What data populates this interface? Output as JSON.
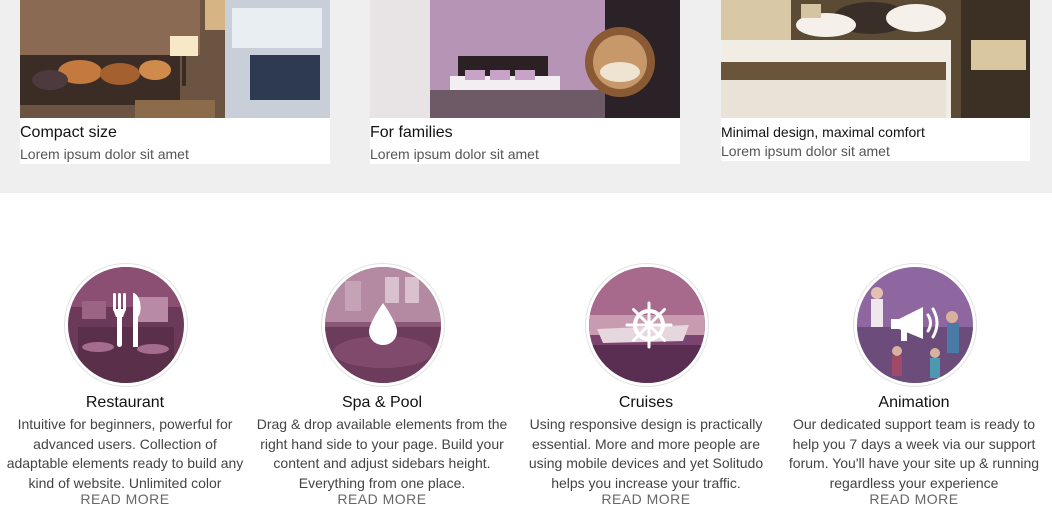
{
  "rooms": [
    {
      "title": "Compact size",
      "subtitle": "Lorem ipsum dolor sit amet"
    },
    {
      "title": "For families",
      "subtitle": "Lorem ipsum dolor sit amet"
    },
    {
      "title": "Minimal design, maximal comfort",
      "subtitle": "Lorem ipsum dolor sit amet"
    }
  ],
  "services": [
    {
      "title": "Restaurant",
      "icon": "fork-knife-icon",
      "lines": [
        "Intuitive for beginners, powerful for",
        "advanced users. Collection of",
        "adaptable elements ready to build any",
        "kind of website. Unlimited color"
      ],
      "read_more": "READ MORE"
    },
    {
      "title": "Spa & Pool",
      "icon": "water-drop-icon",
      "lines": [
        "Drag & drop available elements from the",
        "right hand side to your page. Build your",
        "content and adjust sidebars height.",
        "Everything from one place."
      ],
      "read_more": "READ MORE"
    },
    {
      "title": "Cruises",
      "icon": "ship-wheel-icon",
      "lines": [
        "Using responsive design is practically",
        "essential. More and more people are",
        "using mobile devices and yet Solitudo",
        "helps you increase your traffic."
      ],
      "read_more": "READ MORE"
    },
    {
      "title": "Animation",
      "icon": "megaphone-icon",
      "lines": [
        "Our dedicated support team is ready to",
        "help you 7 days a week via our support",
        "forum. You'll have your site up & running",
        "regardless your experience"
      ],
      "read_more": "READ MORE"
    }
  ],
  "colors": {
    "overlay": "#7a3d78",
    "band": "#efefef"
  }
}
